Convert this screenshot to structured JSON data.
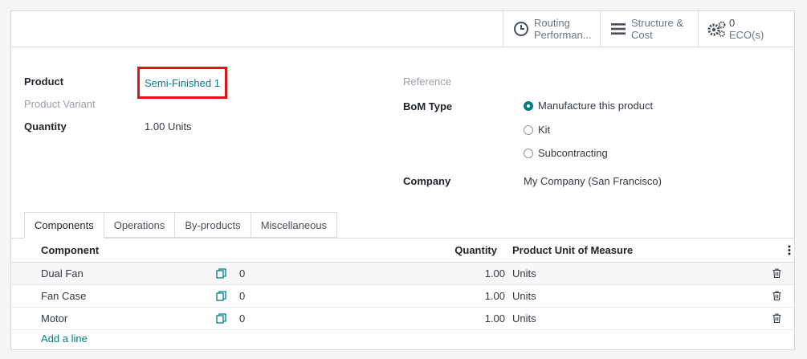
{
  "stat_buttons": {
    "routing": {
      "line1": "Routing",
      "line2": "Performan..."
    },
    "structure": {
      "line1": "Structure &",
      "line2": "Cost"
    },
    "eco": {
      "line1": "0",
      "line2": "ECO(s)"
    }
  },
  "form": {
    "product_label": "Product",
    "product_value": "Semi-Finished 1",
    "variant_label": "Product Variant",
    "quantity_label": "Quantity",
    "quantity_value": "1.00",
    "quantity_uom": "Units",
    "reference_label": "Reference",
    "bom_type_label": "BoM Type",
    "bom_type_options": [
      "Manufacture this product",
      "Kit",
      "Subcontracting"
    ],
    "bom_type_selected": "Manufacture this product",
    "company_label": "Company",
    "company_value": "My Company (San Francisco)"
  },
  "tabs": [
    "Components",
    "Operations",
    "By-products",
    "Miscellaneous"
  ],
  "active_tab": "Components",
  "table": {
    "headers": {
      "component": "Component",
      "quantity": "Quantity",
      "uom": "Product Unit of Measure"
    },
    "rows": [
      {
        "component": "Dual Fan",
        "forecast": "0",
        "quantity": "1.00",
        "uom": "Units"
      },
      {
        "component": "Fan Case",
        "forecast": "0",
        "quantity": "1.00",
        "uom": "Units"
      },
      {
        "component": "Motor",
        "forecast": "0",
        "quantity": "1.00",
        "uom": "Units"
      }
    ],
    "add_line": "Add a line"
  },
  "colors": {
    "accent": "#017e84",
    "highlight_box": "#e1141a"
  }
}
